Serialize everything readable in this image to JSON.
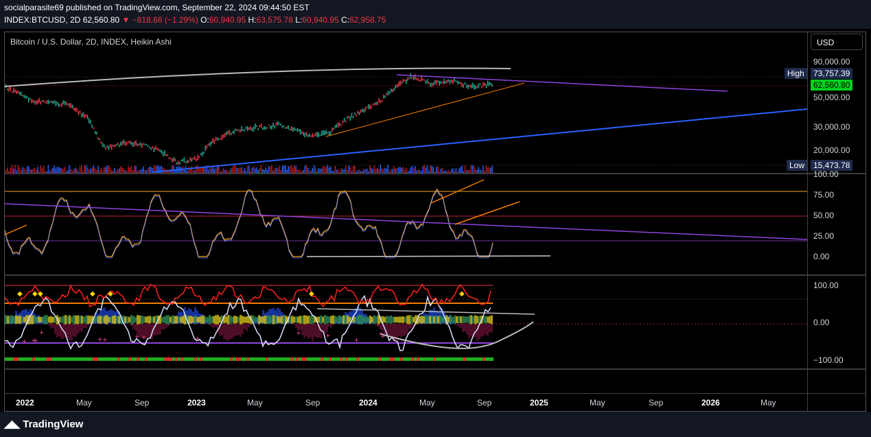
{
  "header": {
    "published": "socialparasite69 published on TradingView.com, September 22, 2024 09:44:50 EST",
    "symbol": "INDEX:BTCUSD, 2D",
    "last": "62,560.80",
    "change": "−818.66 (−1.29%)",
    "o_label": "O:",
    "o": "60,940.95",
    "h_label": "H:",
    "h": "63,575.78",
    "l_label": "L:",
    "l": "60,940.95",
    "c_label": "C:",
    "c": "62,958.75"
  },
  "legend": "Bitcoin / U.S. Dollar, 2D, INDEX, Heikin Ashi",
  "currency": "USD",
  "price_axis": [
    "90,000.00",
    "50,000.00",
    "30,000.00",
    "20,000.00"
  ],
  "high": {
    "label": "High",
    "value": "73,757.39"
  },
  "current": "62,560.80",
  "low": {
    "label": "Low",
    "value": "15,473.78"
  },
  "rsi_axis": [
    "100.00",
    "75.00",
    "50.00",
    "25.00",
    "0.00"
  ],
  "osc_axis": [
    "100.00",
    "0.00",
    "−100.00"
  ],
  "time_axis": [
    "2022",
    "May",
    "Sep",
    "2023",
    "May",
    "Sep",
    "2024",
    "May",
    "Sep",
    "2025",
    "May",
    "Sep",
    "2026",
    "May"
  ],
  "brand": "TradingView",
  "colors": {
    "up": "#22ab94",
    "down": "#f23645",
    "accent": "#2962ff",
    "current_badge": "#00d11c"
  }
}
